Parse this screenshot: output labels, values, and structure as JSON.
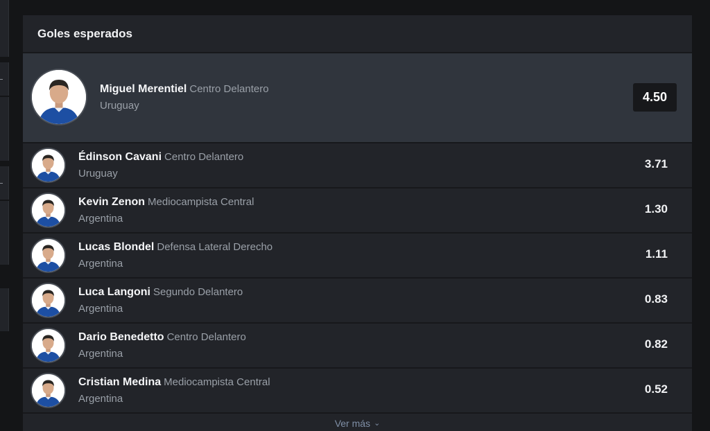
{
  "panel": {
    "title": "Goles esperados",
    "see_more_label": "Ver más"
  },
  "featured": {
    "name": "Miguel Merentiel",
    "position": "Centro Delantero",
    "country": "Uruguay",
    "value": "4.50"
  },
  "rows": [
    {
      "name": "Édinson Cavani",
      "position": "Centro Delantero",
      "country": "Uruguay",
      "value": "3.71"
    },
    {
      "name": "Kevin Zenon",
      "position": "Mediocampista Central",
      "country": "Argentina",
      "value": "1.30"
    },
    {
      "name": "Lucas Blondel",
      "position": "Defensa Lateral Derecho",
      "country": "Argentina",
      "value": "1.11"
    },
    {
      "name": "Luca Langoni",
      "position": "Segundo Delantero",
      "country": "Argentina",
      "value": "0.83"
    },
    {
      "name": "Dario Benedetto",
      "position": "Centro Delantero",
      "country": "Argentina",
      "value": "0.82"
    },
    {
      "name": "Cristian Medina",
      "position": "Mediocampista Central",
      "country": "Argentina",
      "value": "0.52"
    }
  ],
  "icons": {
    "see_more": "chevron-down-icon",
    "avatar": "player-avatar"
  },
  "colors": {
    "background": "#141517",
    "panel": "#222429",
    "featured_row": "#30353d",
    "value_box": "#17181b",
    "secondary_text": "#9aa0a8",
    "link": "#7f8fa6",
    "jersey": "#1d4fa3"
  }
}
